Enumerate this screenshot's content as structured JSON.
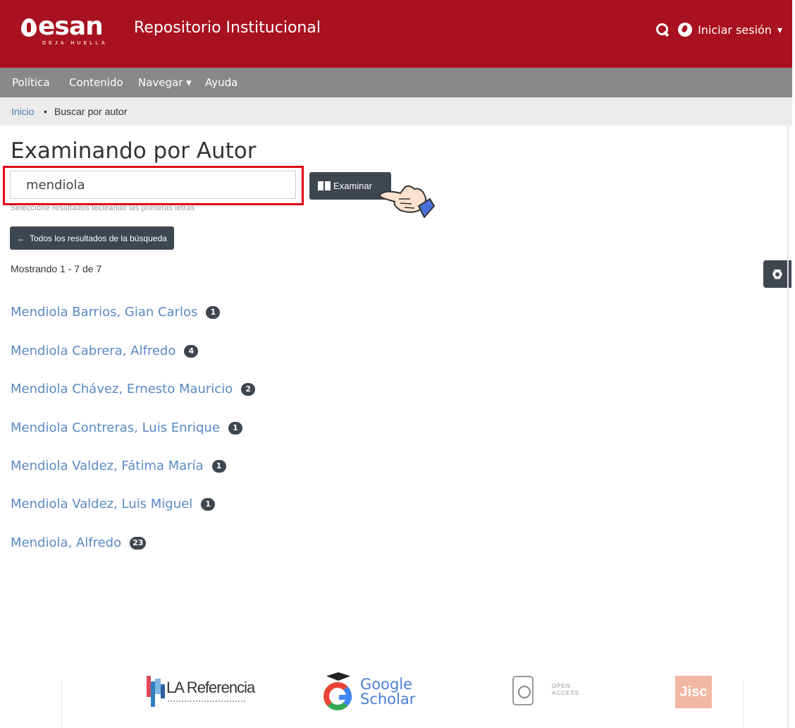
{
  "header": {
    "logo_word": "esan",
    "logo_tagline": "DEJA HUELLA",
    "title": "Repositorio Institucional",
    "login_label": "Iniciar sesión",
    "login_caret": "▾"
  },
  "nav": {
    "items": [
      {
        "label": "Política"
      },
      {
        "label": "Contenido"
      },
      {
        "label": "Navegar ▾"
      },
      {
        "label": "Ayuda"
      }
    ]
  },
  "breadcrumb": {
    "home": "Inicio",
    "separator": "•",
    "current": "Buscar por autor"
  },
  "main": {
    "title": "Examinando por Autor",
    "search_value": "mendiola",
    "browse_label": "Examinar",
    "hint": "Seleccione resultados tecleando las primeras letras",
    "back_label": "Todos los resultados de la búsqueda",
    "back_arrow": "←",
    "showing": "Mostrando 1 - 7 de 7"
  },
  "results": [
    {
      "name": "Mendiola Barrios, Gian Carlos",
      "count": "1"
    },
    {
      "name": "Mendiola Cabrera, Alfredo",
      "count": "4"
    },
    {
      "name": "Mendiola Chávez, Ernesto Mauricio",
      "count": "2"
    },
    {
      "name": "Mendiola Contreras, Luis Enrique",
      "count": "1"
    },
    {
      "name": "Mendiola Valdez, Fátima María",
      "count": "1"
    },
    {
      "name": "Mendiola Valdez, Luis Miguel",
      "count": "1"
    },
    {
      "name": "Mendiola, Alfredo",
      "count": "23"
    }
  ],
  "footer": {
    "la_referencia": "LA Referencia",
    "google_line1": "Google",
    "google_line2": "Scholar",
    "open_access_line1": "OPEN",
    "open_access_line2": "ACCESS",
    "jisc": "Jisc"
  },
  "colors": {
    "header_bg": "#a81120",
    "nav_bg": "#898989",
    "button_bg": "#3e4650",
    "link": "#5a89c4",
    "highlight": "#e00016"
  },
  "icons": [
    "search-icon",
    "globe-icon",
    "book-icon",
    "pointing-hand-icon",
    "gear-icon",
    "arrow-left-icon"
  ]
}
